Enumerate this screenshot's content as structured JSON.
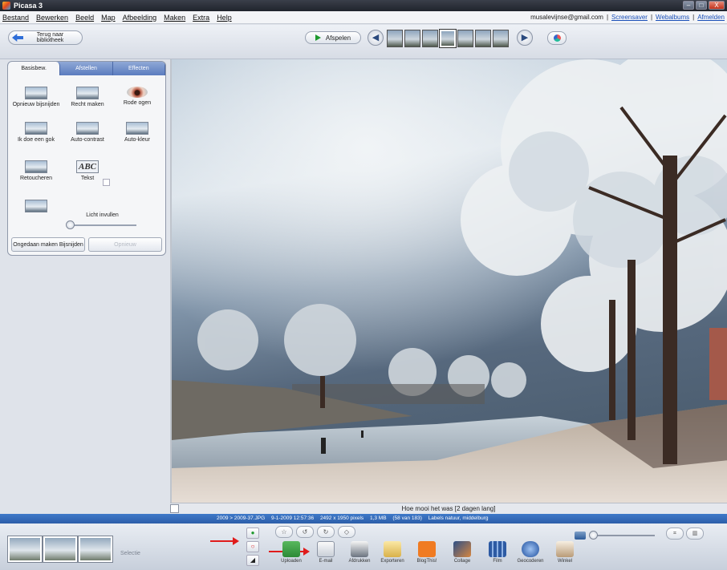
{
  "window": {
    "title": "Picasa 3",
    "controls": [
      "–",
      "□",
      "X"
    ]
  },
  "menu": {
    "items": [
      "Bestand",
      "Bewerken",
      "Beeld",
      "Map",
      "Afbeelding",
      "Maken",
      "Extra",
      "Help"
    ]
  },
  "account": {
    "email": "musalevijnse@gmail.com",
    "links": [
      "Screensaver",
      "Webalbums",
      "Afmelden"
    ]
  },
  "toolbar": {
    "back_label": "Terug naar bibliotheek",
    "play_label": "Afspelen"
  },
  "edit_panel": {
    "tabs": [
      "Basisbew.",
      "Afstellen",
      "Effecten"
    ],
    "tools": [
      "Opnieuw bijsnijden",
      "Recht maken",
      "Rode ogen",
      "Ik doe een gok",
      "Auto-contrast",
      "Auto-kleur",
      "Retoucheren",
      "Tekst"
    ],
    "slider_label": "Licht invullen",
    "undo_label": "Ongedaan maken Bijsnijden",
    "redo_label": "Opnieuw"
  },
  "photo": {
    "caption": "Hoe mooi het was [2 dagen lang]"
  },
  "info": {
    "filename": "2009 > 2009-37.JPG",
    "date": "9-1-2009 12:57:36",
    "size_px": "2492 x 1950 pixels",
    "size_mb": "1,3 MB",
    "position": "(58 van 183)",
    "labels": "Labels natuur, middelburg"
  },
  "tray": {
    "selection_label": "Selectie",
    "share_actions": [
      "Uploaden",
      "E-mail",
      "Afdrukken",
      "Exporteren",
      "BlogThis!",
      "Collage",
      "Film",
      "Geocoderen",
      "Winkel"
    ]
  },
  "colors": {
    "accent": "#2c5ea9",
    "arrow": "#e01b1b"
  }
}
